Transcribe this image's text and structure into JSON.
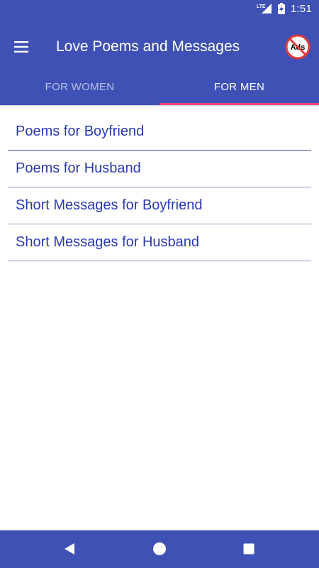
{
  "status_bar": {
    "network_label": "LTE",
    "time": "1:51"
  },
  "toolbar": {
    "title": "Love Poems and Messages",
    "no_ads_label": "Ads"
  },
  "tabs": [
    {
      "label": "FOR WOMEN",
      "selected": false
    },
    {
      "label": "FOR MEN",
      "selected": true
    }
  ],
  "list": {
    "items": [
      {
        "label": "Poems for Boyfriend"
      },
      {
        "label": "Poems for Husband"
      },
      {
        "label": "Short Messages for Boyfriend"
      },
      {
        "label": "Short Messages for Husband"
      }
    ]
  },
  "colors": {
    "primary": "#3f51b5",
    "accent_indicator": "#ff4081",
    "list_text": "#2a3ab2",
    "divider": "#8f96c8"
  },
  "icons": {
    "menu": "hamburger-menu-icon",
    "no_ads": "no-ads-icon",
    "signal": "signal-icon",
    "battery": "battery-charging-icon",
    "back": "back-triangle-icon",
    "home": "home-circle-icon",
    "recents": "recents-square-icon"
  }
}
